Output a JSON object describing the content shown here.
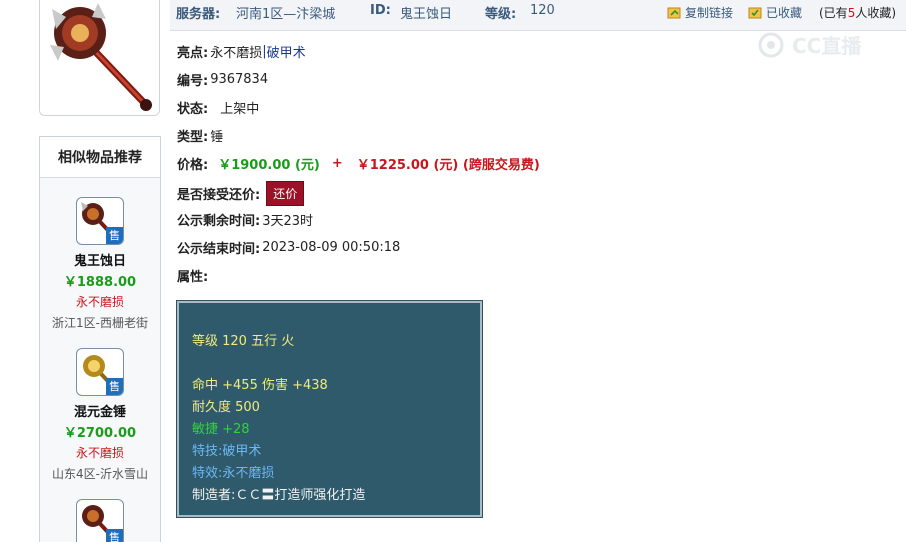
{
  "header": {
    "server_label": "服务器:",
    "server_value": "河南1区—汴梁城",
    "id_label": "ID:",
    "id_value": "鬼王蚀日",
    "level_label": "等级:",
    "level_value": "120",
    "copy_link": "复制链接",
    "favorited": "已收藏",
    "fav_count_prefix": "(已有",
    "fav_count": "5",
    "fav_count_suffix": "人收藏)"
  },
  "watermark": {
    "text": "CC直播"
  },
  "details": {
    "highlight_label": "亮点:",
    "highlight_1": "永不磨损",
    "highlight_sep": "|",
    "highlight_2": "破甲术",
    "number_label": "编号:",
    "number_value": "9367834",
    "status_label": "状态:",
    "status_value": "上架中",
    "type_label": "类型:",
    "type_value": "锤",
    "price_label": "价格:",
    "price_main": "￥1900.00 (元)",
    "price_plus": "+",
    "price_fee": "￥1225.00 (元) (跨服交易费)",
    "counter_label": "是否接受还价:",
    "counter_button": "还价",
    "remaining_label": "公示剩余时间:",
    "remaining_value": "3天23时",
    "end_label": "公示结束时间:",
    "end_value": "2023-08-09 00:50:18",
    "attr_label": "属性:"
  },
  "attributes": [
    {
      "text": "等级 120 五行 火",
      "color": "#f1eb7b"
    },
    {
      "text": "",
      "color": "#f1eb7b"
    },
    {
      "text": "命中 +455 伤害 +438",
      "color": "#f1eb7b"
    },
    {
      "text": "耐久度 500",
      "color": "#f1eb7b"
    },
    {
      "text": "敏捷 +28",
      "color": "#33d23a"
    },
    {
      "text": "特技:破甲术",
      "color": "#6cb8f0"
    },
    {
      "text": "特效:永不磨损",
      "color": "#6cb8f0"
    },
    {
      "text": "制造者:ＣＣ〓打造师强化打造",
      "color": "#f2f2f2"
    }
  ],
  "similar": {
    "title": "相似物品推荐",
    "sell_tag": "售",
    "items": [
      {
        "name": "鬼王蚀日",
        "price": "￥1888.00",
        "tag": "永不磨损",
        "server": "浙江1区-西栅老街",
        "icon": "hammer-icon"
      },
      {
        "name": "混元金锤",
        "price": "￥2700.00",
        "tag": "永不磨损",
        "server": "山东4区-沂水雪山",
        "icon": "golden-hammer-icon"
      },
      {
        "name": "",
        "price": "",
        "tag": "",
        "server": "",
        "icon": "hammer-icon"
      }
    ]
  }
}
